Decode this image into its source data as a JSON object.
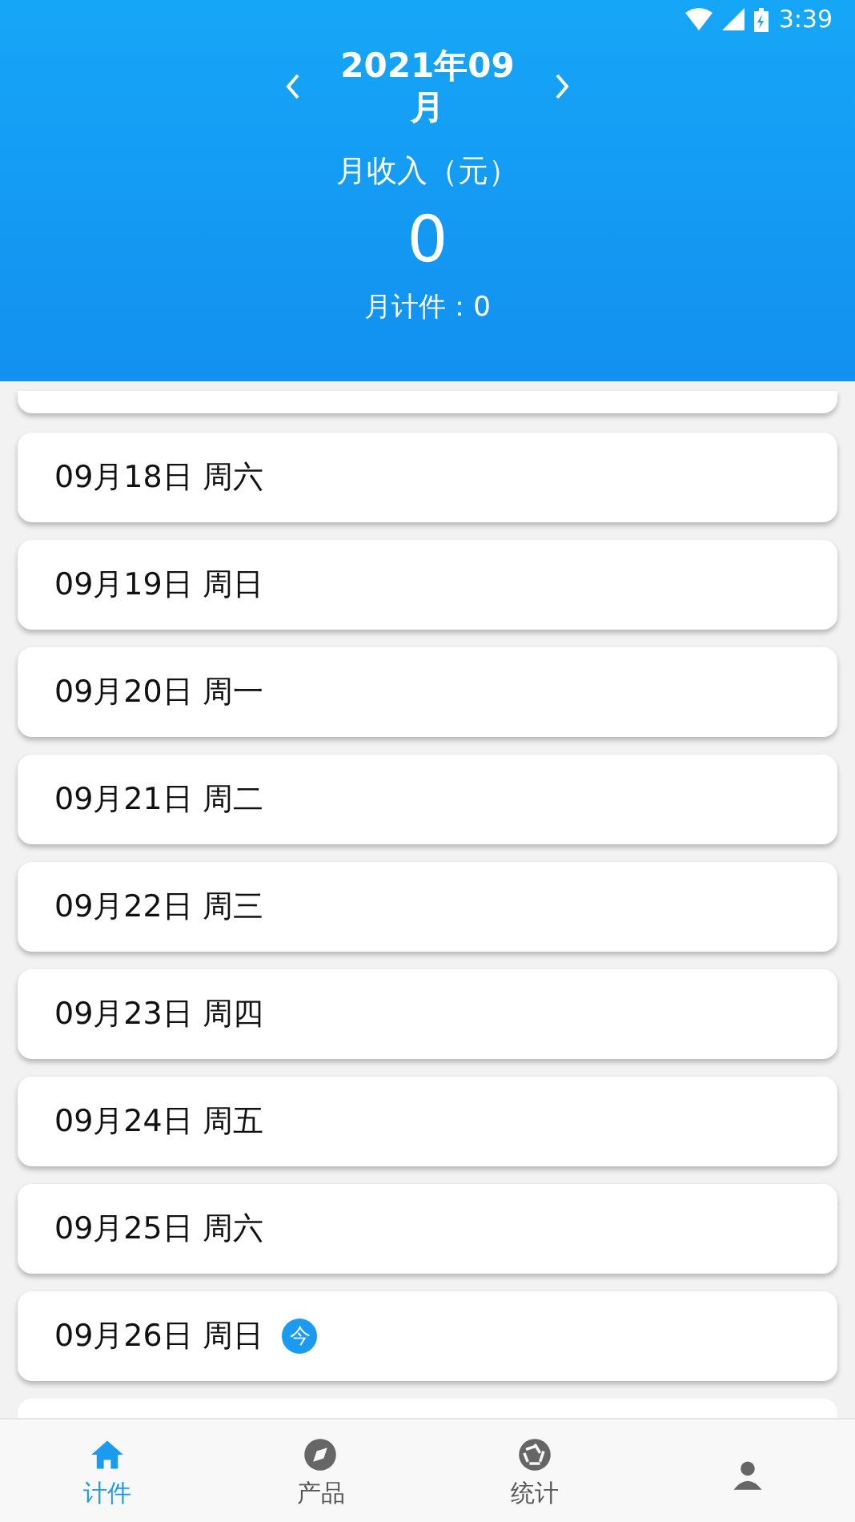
{
  "status_bar": {
    "time": "3:39"
  },
  "header": {
    "month": "2021年09月",
    "income_label": "月收入（元）",
    "income": "0",
    "count_label": "月计件：0"
  },
  "days": [
    {
      "date": "09月18日",
      "weekday": "周六",
      "today": false
    },
    {
      "date": "09月19日",
      "weekday": "周日",
      "today": false
    },
    {
      "date": "09月20日",
      "weekday": "周一",
      "today": false
    },
    {
      "date": "09月21日",
      "weekday": "周二",
      "today": false
    },
    {
      "date": "09月22日",
      "weekday": "周三",
      "today": false
    },
    {
      "date": "09月23日",
      "weekday": "周四",
      "today": false
    },
    {
      "date": "09月24日",
      "weekday": "周五",
      "today": false
    },
    {
      "date": "09月25日",
      "weekday": "周六",
      "today": false
    },
    {
      "date": "09月26日",
      "weekday": "周日",
      "today": true,
      "today_badge": "今"
    }
  ],
  "tabs": [
    {
      "kind": "home",
      "label": "计件",
      "selected": true
    },
    {
      "kind": "compass",
      "label": "产品",
      "selected": false
    },
    {
      "kind": "aperture",
      "label": "统计",
      "selected": false
    },
    {
      "kind": "other",
      "selected": false
    }
  ]
}
